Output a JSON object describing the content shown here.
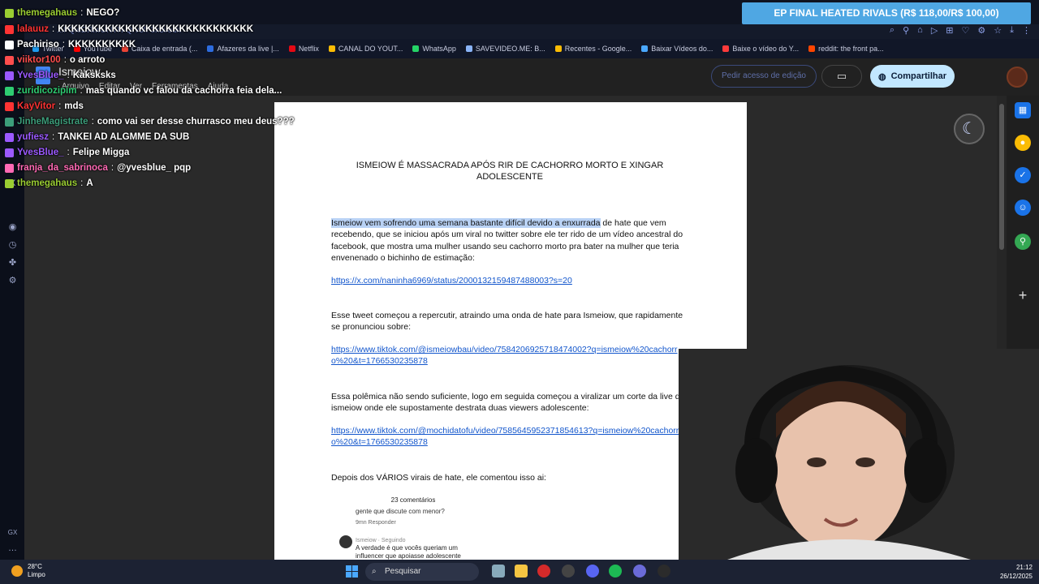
{
  "browser": {
    "url": "...FQieDRlwUNTH-Qrv8fF3k3i/edit",
    "bookmarks": [
      {
        "label": "Twitter",
        "color": "#1d9bf0"
      },
      {
        "label": "YouTube",
        "color": "#ff0000"
      },
      {
        "label": "Caixa de entrada (...",
        "color": "#ea4335"
      },
      {
        "label": "Afazeres da live |...",
        "color": "#2d6cdf"
      },
      {
        "label": "Netflix",
        "color": "#e50914"
      },
      {
        "label": "CANAL DO YOUT...",
        "color": "#fbbc04"
      },
      {
        "label": "WhatsApp",
        "color": "#25d366"
      },
      {
        "label": "SAVEVIDEO.ME: B...",
        "color": "#8ab4f8"
      },
      {
        "label": "Recentes - Google...",
        "color": "#fbbc04"
      },
      {
        "label": "Baixar Vídeos do...",
        "color": "#4aa8ff"
      },
      {
        "label": "Baixe o vídeo do Y...",
        "color": "#ff3b3b"
      },
      {
        "label": "reddit: the front pa...",
        "color": "#ff4500"
      }
    ]
  },
  "docs": {
    "title": "Ismeiow",
    "menu": [
      "Arquivo",
      "Editar",
      "Ver",
      "Ferramentas",
      "Ajuda"
    ],
    "access_label": "Pedir acesso de edição",
    "share_label": "Compartilhar"
  },
  "document": {
    "heading": "ISMEIOW É MASSACRADA APÓS RIR DE CACHORRO MORTO E XINGAR ADOLESCENTE",
    "p1_highlight": "Ismeiow vem sofrendo uma semana bastante difícil devido a enxurrada",
    "p1_rest": " de hate que vem recebendo, que se iniciou após um viral no twitter sobre ele ter rido de um vídeo ancestral do facebook, que mostra uma mulher usando seu cachorro morto pra bater na mulher que teria envenenado o bichinho de estimação:",
    "link1": "https://x.com/naninha6969/status/2000132159487488003?s=20",
    "p2": "Esse tweet começou a repercutir, atraindo uma onda de hate para Ismeiow, que rapidamente se pronunciou sobre:",
    "link2": "https://www.tiktok.com/@ismeiowbau/video/7584206925718474002?q=ismeiow%20cachorro%20&t=1766530235878",
    "p3": "Essa polêmica não sendo suficiente, logo em seguida começou a viralizar um corte da live de ismeiow onde ele supostamente destrata duas viewers adolescente:",
    "link3": "https://www.tiktok.com/@mochidatofu/video/7585645952371854613?q=ismeiow%20cachorro%20&t=1766530235878",
    "p4": "Depois dos VÁRIOS virais de hate, ele comentou isso ai:",
    "embed_title": "23 comentários",
    "embed_line1": "gente que discute com menor?",
    "embed_meta": "9mn   Responder",
    "embed_user": "Ismeiow · Seguindo",
    "embed_line2": "A verdade é que vocês queriam um",
    "embed_line3": "influencer que apoiasse adolescente"
  },
  "chat": [
    {
      "user": "themegahaus",
      "text": "NEGO?",
      "color": "#9acd32"
    },
    {
      "user": "lalauuz",
      "text": "KKKKKKKKKKKKKKKKKKKKKKKKKKKKK",
      "color": "#ff3333"
    },
    {
      "user": "Pachiriso",
      "text": "KKKKKKKKKK",
      "color": "#ffffff"
    },
    {
      "user": "viiktor100",
      "text": "o arroto",
      "color": "#ff4d4d"
    },
    {
      "user": "YvesBlue_",
      "text": "Kaksksks",
      "color": "#9b59ff"
    },
    {
      "user": "zuridicozipim",
      "text": "mas quando vc falou da cachorra feia dela...",
      "color": "#2ecc71"
    },
    {
      "user": "KayVitor",
      "text": "mds",
      "color": "#ff3333"
    },
    {
      "user": "JinheMagistrate",
      "text": "como vai ser desse churrasco meu deus???",
      "color": "#3c9d7a"
    },
    {
      "user": "yufiesz",
      "text": "TANKEI AD ALGMME DA SUB",
      "color": "#9b59ff"
    },
    {
      "user": "YvesBlue_",
      "text": "Felipe Migga",
      "color": "#9b59ff"
    },
    {
      "user": "franja_da_sabrinoca",
      "text": "@yvesblue_ pqp",
      "color": "#ff69b4"
    },
    {
      "user": "themegahaus",
      "text": "A",
      "color": "#9acd32"
    }
  ],
  "banner": {
    "text": "EP FINAL HEATED RIVALS (R$ 118,00/R$ 100,00)"
  },
  "taskbar": {
    "temp": "28°C",
    "weather": "Limpo",
    "search": "Pesquisar",
    "time": "21:12",
    "date": "26/12/2025"
  },
  "icons": [
    "moon-icon",
    "share-icon",
    "camera-icon",
    "search-icon",
    "windows-start-icon"
  ]
}
